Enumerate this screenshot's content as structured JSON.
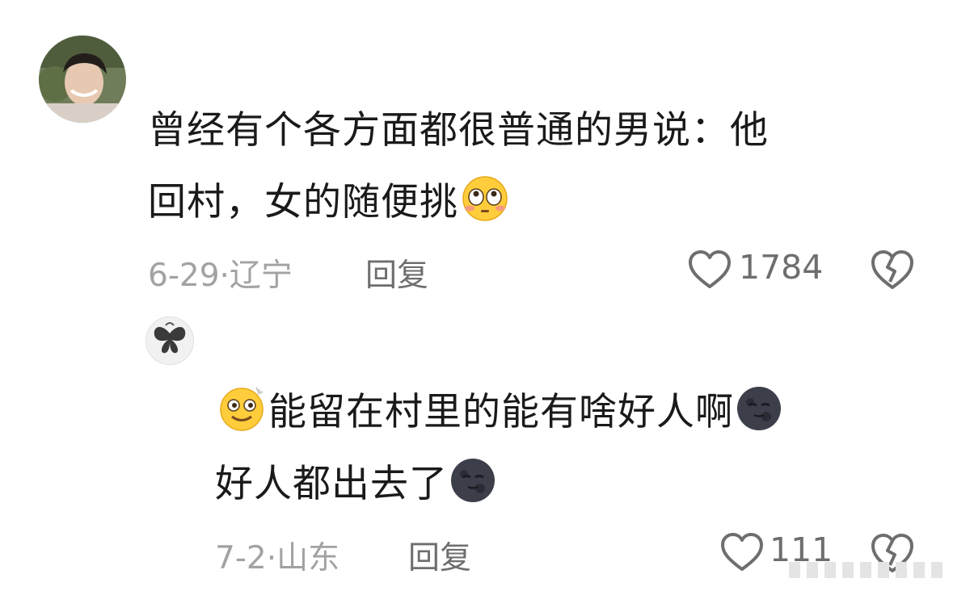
{
  "comments": [
    {
      "line1": "曾经有个各方面都很普通的男说：他",
      "line2": "回村，女的随便挑",
      "emoji": "flushed-face",
      "date": "6-29",
      "location": "辽宁",
      "reply": "回复",
      "likes": "1784"
    },
    {
      "line1": "能留在村里的能有啥好人啊",
      "line2": "好人都出去了",
      "emoji_start": "dizzy-smile-face",
      "emoji_end": "new-moon-face",
      "date": "7-2",
      "location": "山东",
      "reply": "回复",
      "likes": "111"
    }
  ],
  "icons": {
    "like": "heart-outline-icon",
    "dislike": "broken-heart-icon"
  },
  "colors": {
    "text": "#1a1a1a",
    "meta": "#a2a2a2",
    "action": "#6e6e6e"
  }
}
